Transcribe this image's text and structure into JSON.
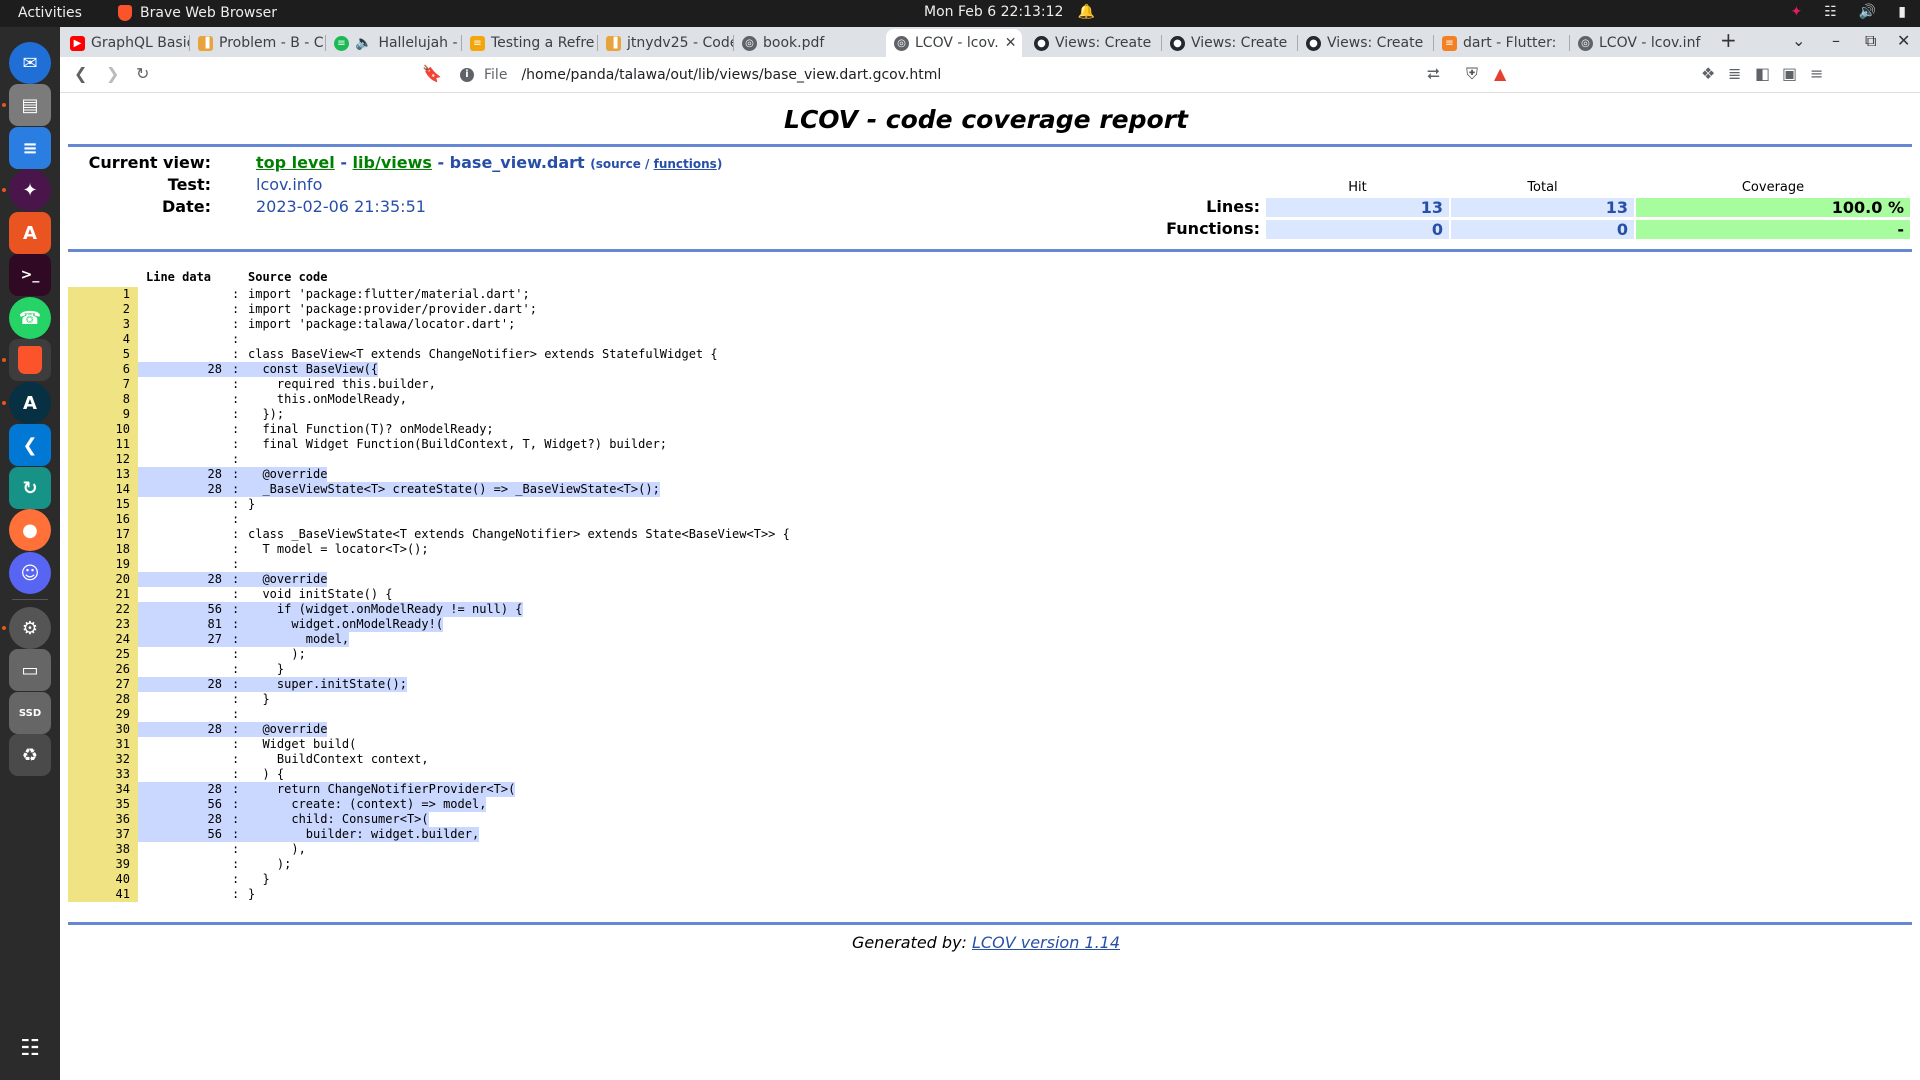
{
  "topbar": {
    "activities": "Activities",
    "app_name": "Brave Web Browser",
    "clock": "Mon Feb 6  22:13:12"
  },
  "dock": {
    "items": [
      "thunderbird-icon",
      "files-icon",
      "writer-icon",
      "slack-icon",
      "app-center-icon",
      "terminal-icon",
      "whatsapp-icon",
      "brave-icon",
      "android-studio-icon",
      "vscode-icon",
      "gitkraken-icon",
      "firefox-icon",
      "discord-icon",
      "settings-icon",
      "drive-icon",
      "ssd-icon",
      "trash-icon",
      "show-apps-icon"
    ]
  },
  "tabs": [
    {
      "label": "GraphQL Basic",
      "fav_color": "#ff0000"
    },
    {
      "label": "Problem - B - C",
      "fav_color": "#e8a33d"
    },
    {
      "label": "Hallelujah -",
      "fav_color": "#1db954"
    },
    {
      "label": "Testing a Refre",
      "fav_color": "#f2a60c"
    },
    {
      "label": "jtnydv25 - Code",
      "fav_color": "#e8a33d"
    },
    {
      "label": "book.pdf",
      "fav_color": "#5f6368"
    },
    {
      "label": "LCOV - lcov.",
      "fav_color": "#5f6368"
    },
    {
      "label": "Views: Create",
      "fav_color": "#24292f"
    },
    {
      "label": "Views: Create",
      "fav_color": "#24292f"
    },
    {
      "label": "Views: Create",
      "fav_color": "#24292f"
    },
    {
      "label": "dart - Flutter:",
      "fav_color": "#f48024"
    },
    {
      "label": "LCOV - lcov.inf",
      "fav_color": "#5f6368"
    }
  ],
  "url": {
    "scheme": "File",
    "path": "/home/panda/talawa/out/lib/views/base_view.dart.gcov.html"
  },
  "report": {
    "title": "LCOV - code coverage report",
    "current_view_label": "Current view:",
    "crumb_top": "top level",
    "crumb_dir": "lib/views",
    "crumb_file": "base_view.dart",
    "source_link": "source",
    "functions_link": "functions",
    "test_label": "Test:",
    "test_value": "lcov.info",
    "date_label": "Date:",
    "date_value": "2023-02-06 21:35:51",
    "col_hit": "Hit",
    "col_total": "Total",
    "col_coverage": "Coverage",
    "lines_label": "Lines:",
    "lines_hit": "13",
    "lines_total": "13",
    "lines_cov": "100.0 %",
    "functions_label": "Functions:",
    "functions_hit": "0",
    "functions_total": "0",
    "functions_cov": "-",
    "line_data_head": "Line data",
    "source_code_head": "Source code",
    "footer_prefix": "Generated by:",
    "footer_link": "LCOV version 1.14"
  },
  "source_lines": [
    {
      "n": "1",
      "c": "",
      "t": "import 'package:flutter/material.dart';"
    },
    {
      "n": "2",
      "c": "",
      "t": "import 'package:provider/provider.dart';"
    },
    {
      "n": "3",
      "c": "",
      "t": "import 'package:talawa/locator.dart';"
    },
    {
      "n": "4",
      "c": "",
      "t": ""
    },
    {
      "n": "5",
      "c": "",
      "t": "class BaseView<T extends ChangeNotifier> extends StatefulWidget {"
    },
    {
      "n": "6",
      "c": "28",
      "t": "  const BaseView({"
    },
    {
      "n": "7",
      "c": "",
      "t": "    required this.builder,"
    },
    {
      "n": "8",
      "c": "",
      "t": "    this.onModelReady,"
    },
    {
      "n": "9",
      "c": "",
      "t": "  });"
    },
    {
      "n": "10",
      "c": "",
      "t": "  final Function(T)? onModelReady;"
    },
    {
      "n": "11",
      "c": "",
      "t": "  final Widget Function(BuildContext, T, Widget?) builder;"
    },
    {
      "n": "12",
      "c": "",
      "t": ""
    },
    {
      "n": "13",
      "c": "28",
      "t": "  @override"
    },
    {
      "n": "14",
      "c": "28",
      "t": "  _BaseViewState<T> createState() => _BaseViewState<T>();"
    },
    {
      "n": "15",
      "c": "",
      "t": "}"
    },
    {
      "n": "16",
      "c": "",
      "t": ""
    },
    {
      "n": "17",
      "c": "",
      "t": "class _BaseViewState<T extends ChangeNotifier> extends State<BaseView<T>> {"
    },
    {
      "n": "18",
      "c": "",
      "t": "  T model = locator<T>();"
    },
    {
      "n": "19",
      "c": "",
      "t": ""
    },
    {
      "n": "20",
      "c": "28",
      "t": "  @override"
    },
    {
      "n": "21",
      "c": "",
      "t": "  void initState() {"
    },
    {
      "n": "22",
      "c": "56",
      "t": "    if (widget.onModelReady != null) {"
    },
    {
      "n": "23",
      "c": "81",
      "t": "      widget.onModelReady!("
    },
    {
      "n": "24",
      "c": "27",
      "t": "        model,"
    },
    {
      "n": "25",
      "c": "",
      "t": "      );"
    },
    {
      "n": "26",
      "c": "",
      "t": "    }"
    },
    {
      "n": "27",
      "c": "28",
      "t": "    super.initState();"
    },
    {
      "n": "28",
      "c": "",
      "t": "  }"
    },
    {
      "n": "29",
      "c": "",
      "t": ""
    },
    {
      "n": "30",
      "c": "28",
      "t": "  @override"
    },
    {
      "n": "31",
      "c": "",
      "t": "  Widget build("
    },
    {
      "n": "32",
      "c": "",
      "t": "    BuildContext context,"
    },
    {
      "n": "33",
      "c": "",
      "t": "  ) {"
    },
    {
      "n": "34",
      "c": "28",
      "t": "    return ChangeNotifierProvider<T>("
    },
    {
      "n": "35",
      "c": "56",
      "t": "      create: (context) => model,"
    },
    {
      "n": "36",
      "c": "28",
      "t": "      child: Consumer<T>("
    },
    {
      "n": "37",
      "c": "56",
      "t": "        builder: widget.builder,"
    },
    {
      "n": "38",
      "c": "",
      "t": "      ),"
    },
    {
      "n": "39",
      "c": "",
      "t": "    );"
    },
    {
      "n": "40",
      "c": "",
      "t": "  }"
    },
    {
      "n": "41",
      "c": "",
      "t": "}"
    }
  ]
}
